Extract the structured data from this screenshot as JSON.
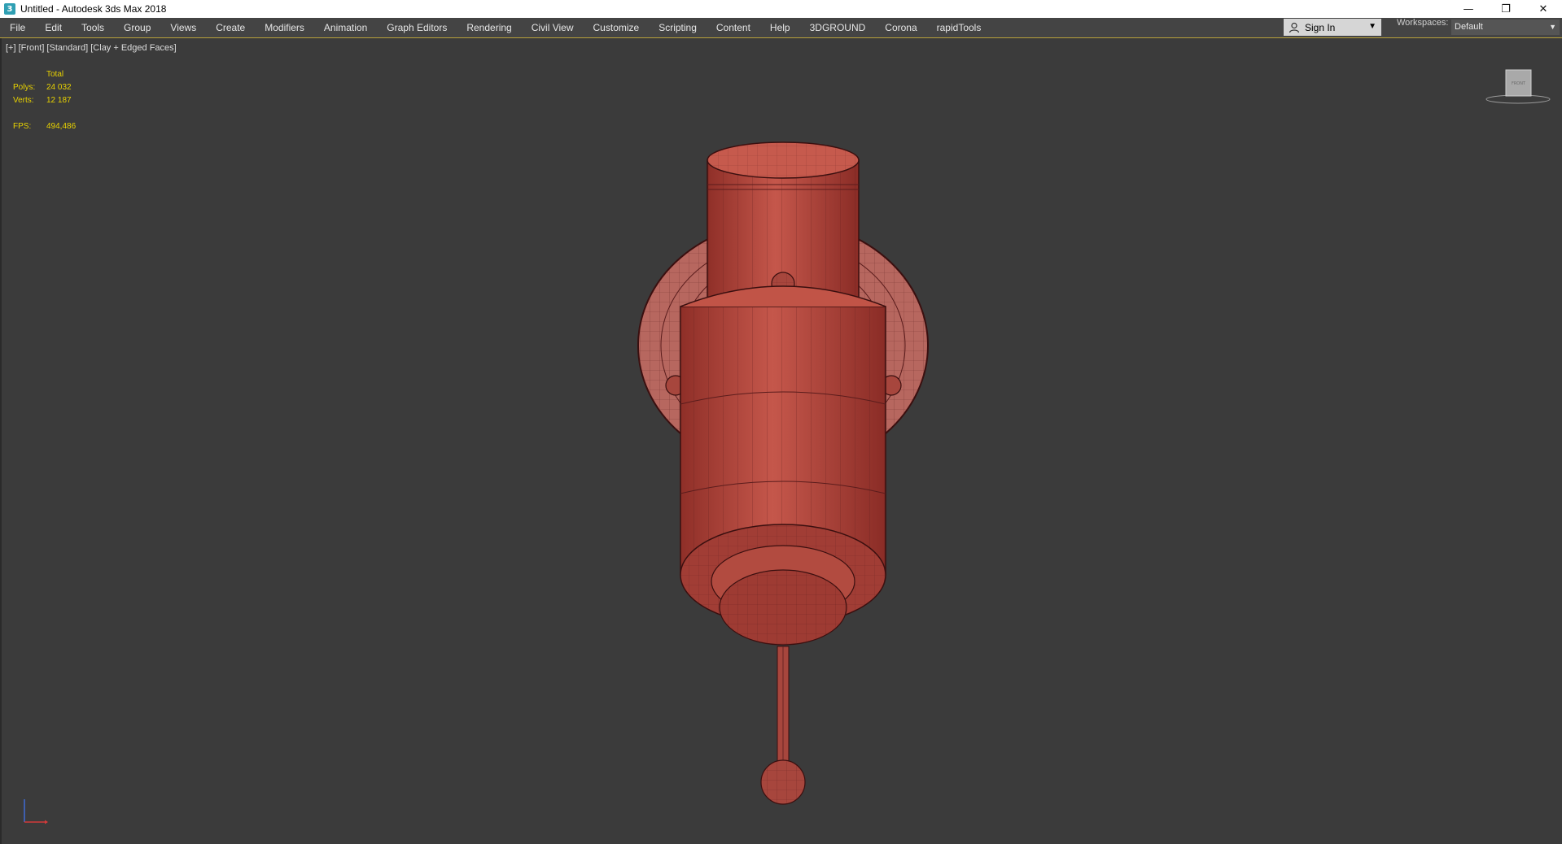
{
  "window": {
    "title": "Untitled - Autodesk 3ds Max 2018",
    "app_icon_glyph": "3",
    "controls": {
      "minimize": "—",
      "maximize": "❐",
      "close": "✕"
    }
  },
  "menu": {
    "items": [
      "File",
      "Edit",
      "Tools",
      "Group",
      "Views",
      "Create",
      "Modifiers",
      "Animation",
      "Graph Editors",
      "Rendering",
      "Civil View",
      "Customize",
      "Scripting",
      "Content",
      "Help",
      "3DGROUND",
      "Corona",
      "rapidTools"
    ],
    "sign_in": "Sign In",
    "workspaces_label": "Workspaces:",
    "workspace_value": "Default"
  },
  "viewport": {
    "label": "[+] [Front] [Standard] [Clay + Edged Faces]",
    "stats": {
      "header": "Total",
      "polys_label": "Polys:",
      "polys_value": "24 032",
      "verts_label": "Verts:",
      "verts_value": "12 187",
      "fps_label": "FPS:",
      "fps_value": "494,486"
    },
    "viewcube_face": "FRONT"
  },
  "colors": {
    "accent_yellow": "#e8d200",
    "model_red": "#b8463c",
    "viewport_bg": "#3b3b3b"
  }
}
